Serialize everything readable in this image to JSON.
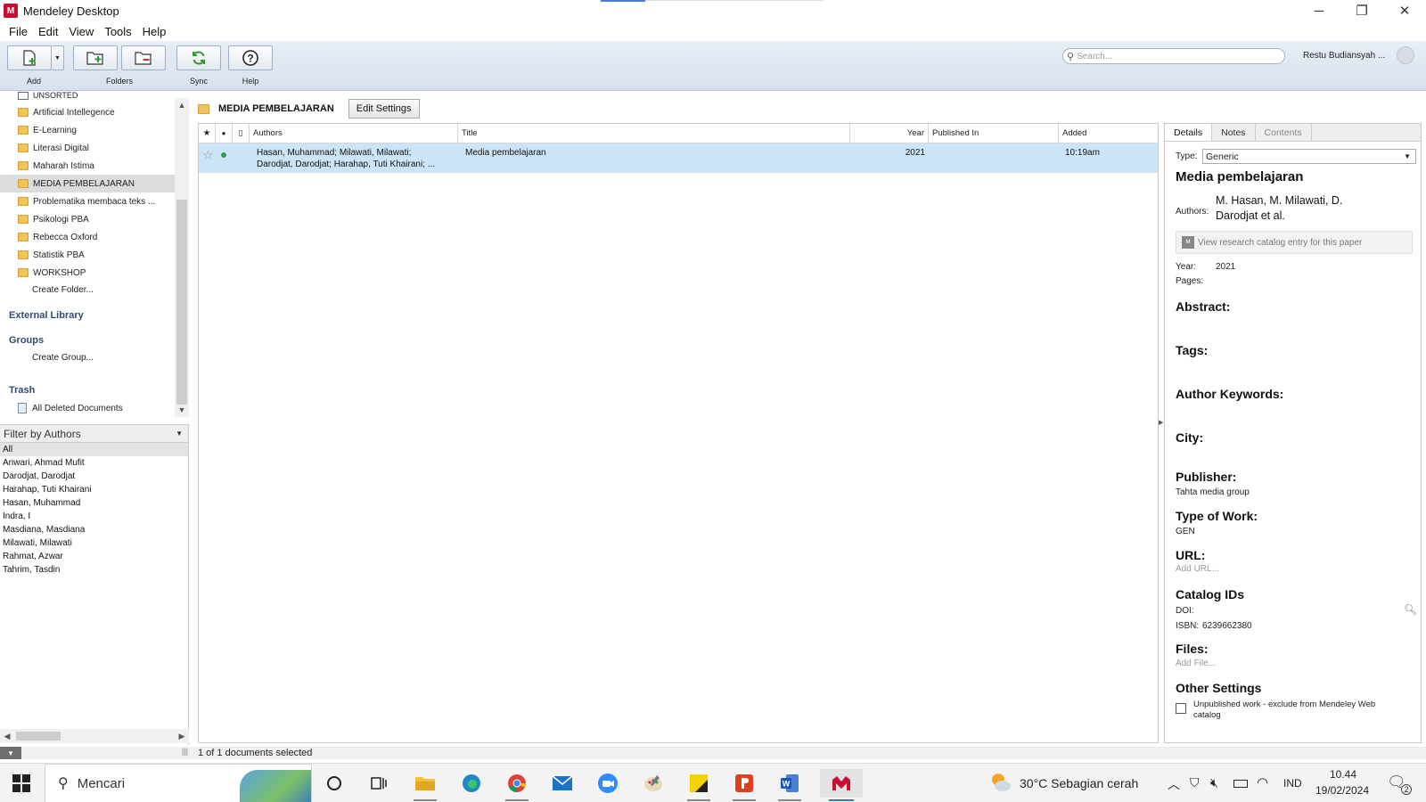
{
  "window": {
    "title": "Mendeley Desktop",
    "logo_text": "M",
    "minimize": "─",
    "restore": "❐",
    "close": "✕"
  },
  "menu": [
    "File",
    "Edit",
    "View",
    "Tools",
    "Help"
  ],
  "toolbar": {
    "add_label": "Add",
    "folders_label": "Folders",
    "sync_label": "Sync",
    "help_label": "Help",
    "search_placeholder": "Search...",
    "user_name": "Restu Budiansyah ..."
  },
  "sidebar": {
    "partial_item": "UNSORTED",
    "collections": [
      "Artificial Intellegence",
      "E-Learning",
      "Literasi Digital",
      "Maharah Istima",
      "MEDIA PEMBELAJARAN",
      "Problematika membaca teks ...",
      "Psikologi PBA",
      "Rebecca Oxford",
      "Statistik PBA",
      "WORKSHOP"
    ],
    "create_folder": "Create Folder...",
    "external_library": "External Library",
    "groups": "Groups",
    "create_group": "Create Group...",
    "trash": "Trash",
    "all_deleted": "All Deleted Documents"
  },
  "filter": {
    "title": "Filter by Authors",
    "items": [
      "All",
      "Anwari, Ahmad Mufit",
      "Darodjat, Darodjat",
      "Harahap, Tuti Khairani",
      "Hasan, Muhammad",
      "Indra, I",
      "Masdiana, Masdiana",
      "Milawati, Milawati",
      "Rahmat, Azwar",
      "Tahrim, Tasdin"
    ]
  },
  "main": {
    "folder_title": "MEDIA PEMBELAJARAN",
    "edit_settings": "Edit Settings",
    "columns": {
      "star": "★",
      "read": "●",
      "file": "▯",
      "authors": "Authors",
      "title": "Title",
      "year": "Year",
      "published_in": "Published In",
      "added": "Added"
    },
    "rows": [
      {
        "star": "☆",
        "authors_line1": "Hasan, Muhammad; Milawati, Milawati;",
        "authors_line2": "Darodjat, Darodjat; Harahap, Tuti Khairani; ...",
        "title": "Media pembelajaran",
        "year": "2021",
        "published_in": "",
        "added": "10:19am"
      }
    ]
  },
  "details": {
    "tabs": [
      "Details",
      "Notes",
      "Contents"
    ],
    "type_label": "Type:",
    "type_value": "Generic",
    "title": "Media pembelajaran",
    "authors_label": "Authors:",
    "authors_line1": "M. Hasan, M. Milawati, D.",
    "authors_line2": "Darodjat et al.",
    "catalog_entry": "View research catalog entry for this paper",
    "year_label": "Year:",
    "year_value": "2021",
    "pages_label": "Pages:",
    "abstract": "Abstract:",
    "tags": "Tags:",
    "author_keywords": "Author Keywords:",
    "city": "City:",
    "publisher": "Publisher:",
    "publisher_value": "Tahta media group",
    "type_of_work": "Type of Work:",
    "type_of_work_value": "GEN",
    "url": "URL:",
    "url_placeholder": "Add URL...",
    "catalog_ids": "Catalog IDs",
    "doi_label": "DOI:",
    "isbn_label": "ISBN:",
    "isbn_value": "6239662380",
    "files": "Files:",
    "files_placeholder": "Add File...",
    "other_settings": "Other Settings",
    "unpublished_line1": "Unpublished work - exclude from Mendeley Web",
    "unpublished_line2": "catalog"
  },
  "status": {
    "text": "1 of 1 documents selected"
  },
  "taskbar": {
    "search": "Mencari",
    "weather": "30°C  Sebagian cerah",
    "lang": "IND",
    "time": "10.44",
    "date": "19/02/2024",
    "notif_count": "2"
  },
  "colors": {
    "selection": "#cce4f7",
    "section_blue": "#2f4a78",
    "mendeley_red": "#c8102e"
  }
}
